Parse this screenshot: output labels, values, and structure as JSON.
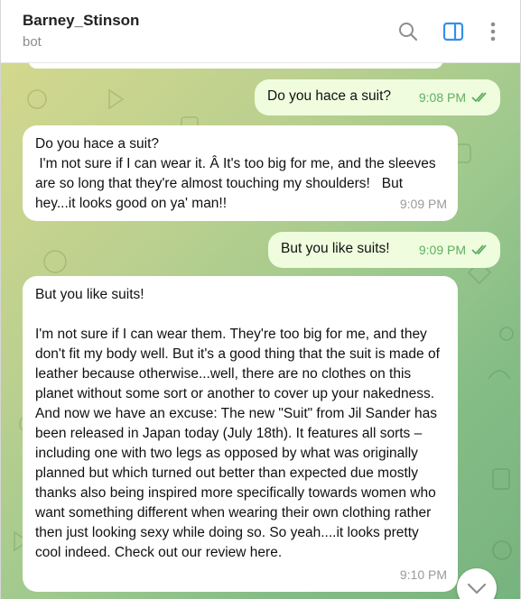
{
  "header": {
    "title": "Barney_Stinson",
    "subtitle": "bot",
    "icons": [
      "search-icon",
      "sidebar-toggle-icon",
      "more-vertical-icon"
    ],
    "accent_color": "#3390ec"
  },
  "messages": [
    {
      "direction": "out",
      "text": "Do you hace a suit?",
      "time": "9:08 PM",
      "status": "read"
    },
    {
      "direction": "in",
      "text": "Do you hace a suit?\n I'm not sure if I can wear it. Â It's too big for me, and the sleeves are so long that they're almost touching my shoulders!   But hey...it looks good on ya' man!!",
      "time": "9:09 PM"
    },
    {
      "direction": "out",
      "text": "But you like suits!",
      "time": "9:09 PM",
      "status": "read"
    },
    {
      "direction": "in",
      "text": "But you like suits!\n\nI'm not sure if I can wear them. They're too big for me, and they don't fit my body well. But it's a good thing that the suit is made of leather because otherwise...well, there are no clothes on this planet without some sort or another to cover up your nakedness. And now we have an excuse: The new \"Suit\" from Jil Sander has been released in Japan today (July 18th). It features all sorts – including one with two legs as opposed by what was originally planned but which turned out better than expected due mostly thanks also being inspired more specifically towards women who want something different when wearing their own clothing rather then just looking sexy while doing so. So yeah....it looks pretty cool indeed. Check out our review here.",
      "time": "9:10 PM"
    }
  ]
}
